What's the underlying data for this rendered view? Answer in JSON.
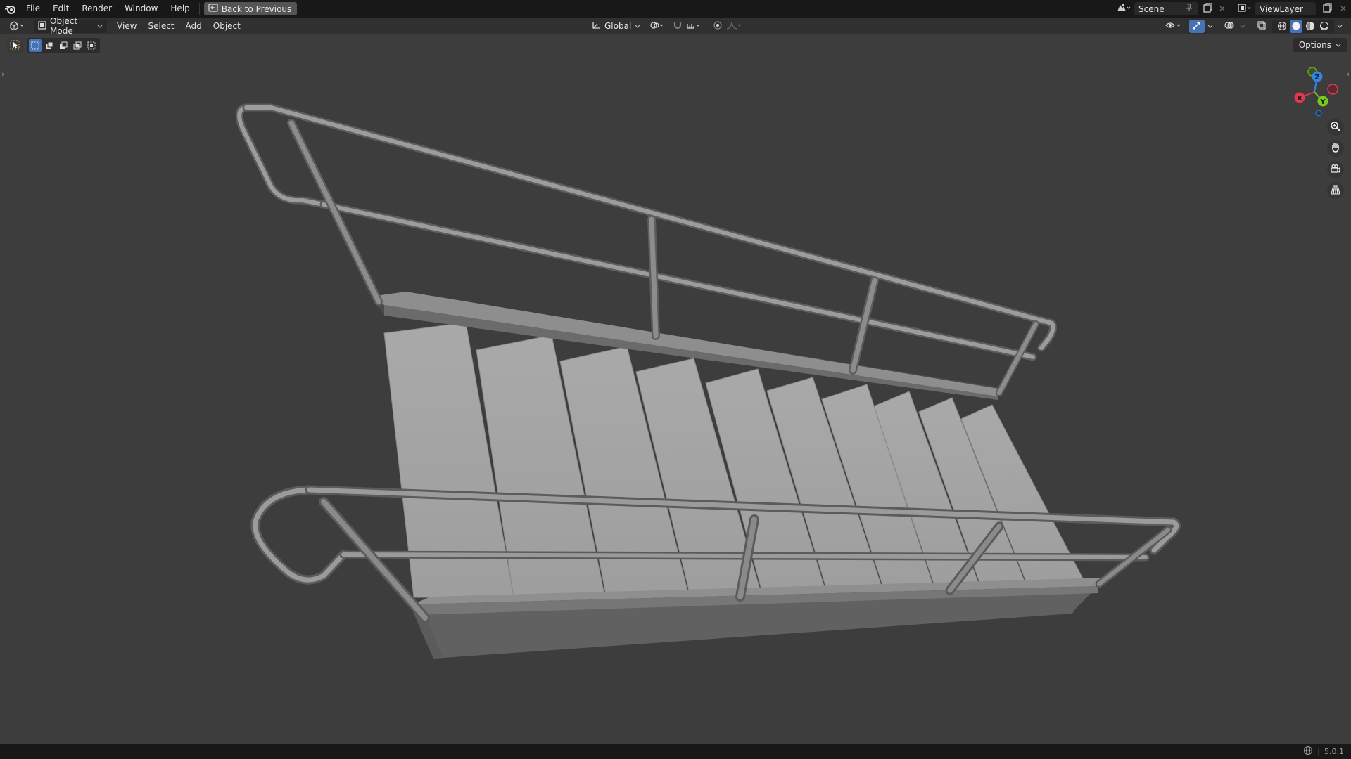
{
  "topbar": {
    "menus": [
      "File",
      "Edit",
      "Render",
      "Window",
      "Help"
    ],
    "back_button": "Back to Previous",
    "scene_name": "Scene",
    "view_layer": "ViewLayer"
  },
  "header": {
    "mode": "Object Mode",
    "menus": [
      "View",
      "Select",
      "Add",
      "Object"
    ],
    "transform_orientation": "Global"
  },
  "viewport": {
    "options_label": "Options",
    "gizmo_axes": [
      "X",
      "Y",
      "Z"
    ],
    "object": "staircase with railings",
    "colors": {
      "background": "#3d3d3d",
      "accent": "#4772b3",
      "axis_x": "#e0394c",
      "axis_y": "#7ac91f",
      "axis_z": "#2e86e5"
    }
  },
  "statusbar": {
    "version": "5.0.1"
  }
}
